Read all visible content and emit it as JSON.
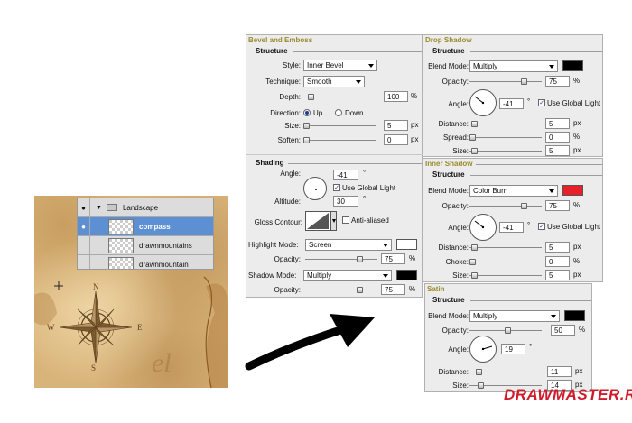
{
  "layers": {
    "group": "Landscape",
    "items": [
      "compass",
      "drawnmountains",
      "drawnmountain"
    ]
  },
  "bevel": {
    "title": "Bevel and Emboss",
    "structure": "Structure",
    "style_label": "Style:",
    "style": "Inner Bevel",
    "technique_label": "Technique:",
    "technique": "Smooth",
    "depth_label": "Depth:",
    "depth": "100",
    "depth_pct": 0.1,
    "direction_label": "Direction:",
    "up": "Up",
    "down": "Down",
    "size_label": "Size:",
    "size": "5",
    "soften_label": "Soften:",
    "soften": "0",
    "shading": "Shading",
    "angle_label": "Angle:",
    "angle": "-41",
    "global_light": "Use Global Light",
    "altitude_label": "Altitude:",
    "altitude": "30",
    "gloss_label": "Gloss Contour:",
    "anti_aliased": "Anti-aliased",
    "highlight_label": "Highlight Mode:",
    "highlight_mode": "Screen",
    "opacity_label": "Opacity:",
    "highlight_opacity": "75",
    "shadow_label": "Shadow Mode:",
    "shadow_mode": "Multiply",
    "shadow_opacity": "75"
  },
  "drop": {
    "title": "Drop Shadow",
    "structure": "Structure",
    "blend_label": "Blend Mode:",
    "blend": "Multiply",
    "opacity_label": "Opacity:",
    "opacity": "75",
    "angle_label": "Angle:",
    "angle": "-41",
    "global_light": "Use Global Light",
    "distance_label": "Distance:",
    "distance": "5",
    "spread_label": "Spread:",
    "spread": "0",
    "size_label": "Size:",
    "size": "5"
  },
  "inner": {
    "title": "Inner Shadow",
    "structure": "Structure",
    "blend_label": "Blend Mode:",
    "blend": "Color Burn",
    "opacity_label": "Opacity:",
    "opacity": "75",
    "angle_label": "Angle:",
    "angle": "-41",
    "global_light": "Use Global Light",
    "distance_label": "Distance:",
    "distance": "5",
    "choke_label": "Choke:",
    "choke": "0",
    "size_label": "Size:",
    "size": "5"
  },
  "satin": {
    "title": "Satin",
    "structure": "Structure",
    "blend_label": "Blend Mode:",
    "blend": "Multiply",
    "opacity_label": "Opacity:",
    "opacity": "50",
    "angle_label": "Angle:",
    "angle": "19",
    "distance_label": "Distance:",
    "distance": "11",
    "size_label": "Size:",
    "size": "14"
  },
  "units": {
    "px": "px",
    "pct": "%",
    "deg": "°"
  },
  "colors": {
    "black": "#000000",
    "red": "#e8202a",
    "highlight": "#ffffff",
    "map": "#d9b47a"
  },
  "logo": "DRAWMASTER.RU"
}
